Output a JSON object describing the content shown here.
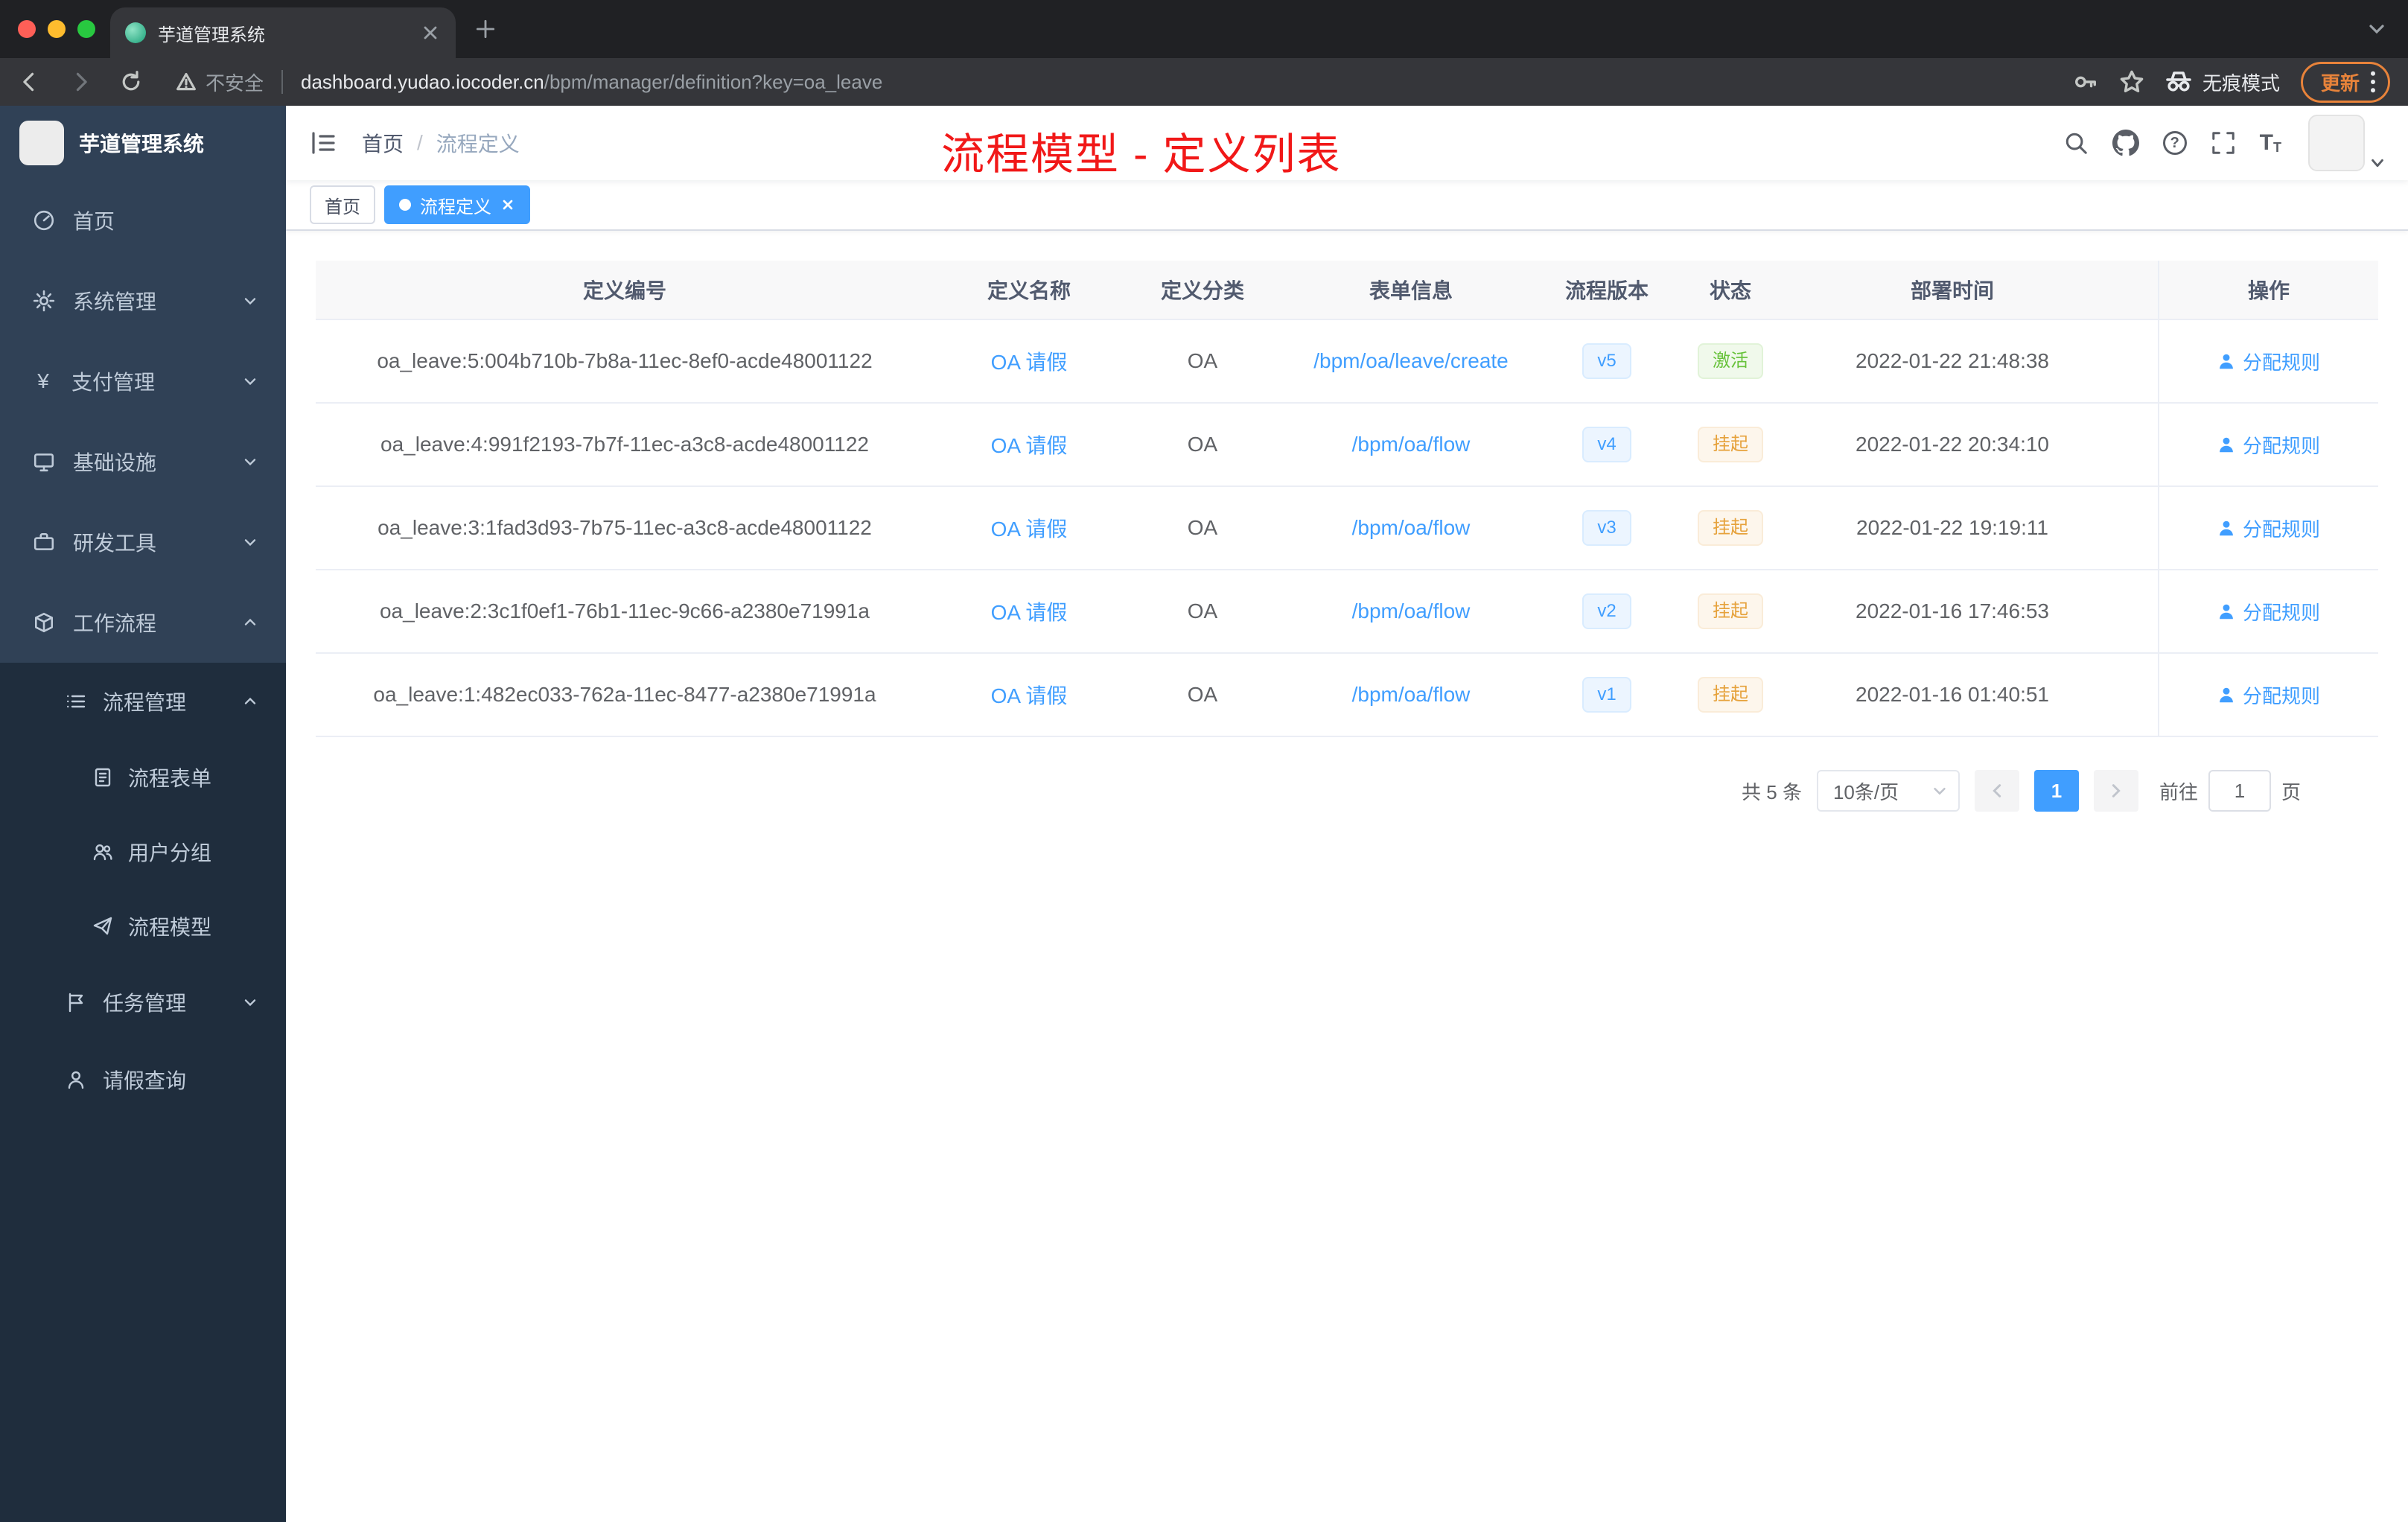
{
  "browser": {
    "tab_title": "芋道管理系统",
    "security_label": "不安全",
    "url_domain": "dashboard.yudao.iocoder.cn",
    "url_path": "/bpm/manager/definition?key=oa_leave",
    "incognito_label": "无痕模式",
    "update_label": "更新"
  },
  "sidebar": {
    "title": "芋道管理系统",
    "items": [
      {
        "label": "首页"
      },
      {
        "label": "系统管理"
      },
      {
        "label": "支付管理"
      },
      {
        "label": "基础设施"
      },
      {
        "label": "研发工具"
      },
      {
        "label": "工作流程"
      }
    ],
    "process_group": {
      "label": "流程管理"
    },
    "process_children": [
      {
        "label": "流程表单"
      },
      {
        "label": "用户分组"
      },
      {
        "label": "流程模型"
      }
    ],
    "task_group": {
      "label": "任务管理"
    },
    "leave_query": {
      "label": "请假查询"
    }
  },
  "header": {
    "breadcrumb_home": "首页",
    "breadcrumb_separator": "/",
    "breadcrumb_current": "流程定义",
    "annotation": "流程模型 - 定义列表"
  },
  "tags": [
    {
      "label": "首页"
    },
    {
      "label": "流程定义"
    }
  ],
  "icons": {
    "yen_glyph": "¥",
    "help_glyph": "?",
    "font_glyph_big": "T",
    "font_glyph_small": "T"
  },
  "table": {
    "columns": [
      "定义编号",
      "定义名称",
      "定义分类",
      "表单信息",
      "流程版本",
      "状态",
      "部署时间",
      "操作"
    ],
    "rows": [
      {
        "id": "oa_leave:5:004b710b-7b8a-11ec-8ef0-acde48001122",
        "name": "OA 请假",
        "category": "OA",
        "form": "/bpm/oa/leave/create",
        "version": "v5",
        "status": "激活",
        "status_type": "success",
        "deploy_time": "2022-01-22 21:48:38",
        "action": "分配规则"
      },
      {
        "id": "oa_leave:4:991f2193-7b7f-11ec-a3c8-acde48001122",
        "name": "OA 请假",
        "category": "OA",
        "form": "/bpm/oa/flow",
        "version": "v4",
        "status": "挂起",
        "status_type": "warning",
        "deploy_time": "2022-01-22 20:34:10",
        "action": "分配规则"
      },
      {
        "id": "oa_leave:3:1fad3d93-7b75-11ec-a3c8-acde48001122",
        "name": "OA 请假",
        "category": "OA",
        "form": "/bpm/oa/flow",
        "version": "v3",
        "status": "挂起",
        "status_type": "warning",
        "deploy_time": "2022-01-22 19:19:11",
        "action": "分配规则"
      },
      {
        "id": "oa_leave:2:3c1f0ef1-76b1-11ec-9c66-a2380e71991a",
        "name": "OA 请假",
        "category": "OA",
        "form": "/bpm/oa/flow",
        "version": "v2",
        "status": "挂起",
        "status_type": "warning",
        "deploy_time": "2022-01-16 17:46:53",
        "action": "分配规则"
      },
      {
        "id": "oa_leave:1:482ec033-762a-11ec-8477-a2380e71991a",
        "name": "OA 请假",
        "category": "OA",
        "form": "/bpm/oa/flow",
        "version": "v1",
        "status": "挂起",
        "status_type": "warning",
        "deploy_time": "2022-01-16 01:40:51",
        "action": "分配规则"
      }
    ]
  },
  "pagination": {
    "total": "共 5 条",
    "page_size": "10条/页",
    "current_page": "1",
    "goto_label": "前往",
    "goto_value": "1",
    "page_unit": "页"
  }
}
